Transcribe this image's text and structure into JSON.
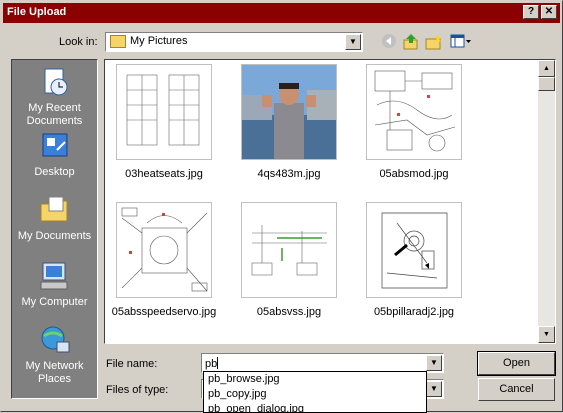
{
  "window": {
    "title": "File Upload",
    "help_glyph": "?",
    "close_glyph": "✕"
  },
  "lookin": {
    "label": "Look in:",
    "value": "My Pictures"
  },
  "toolbar": {
    "back_icon": "back-arrow-icon",
    "up_icon": "up-folder-icon",
    "new_folder_icon": "new-folder-icon",
    "views_icon": "views-menu-icon"
  },
  "places": [
    {
      "label": "My Recent Documents",
      "icon": "recent-documents-icon"
    },
    {
      "label": "Desktop",
      "icon": "desktop-icon"
    },
    {
      "label": "My Documents",
      "icon": "my-documents-icon"
    },
    {
      "label": "My Computer",
      "icon": "my-computer-icon"
    },
    {
      "label": "My Network Places",
      "icon": "network-places-icon"
    }
  ],
  "files": [
    {
      "name": "03heatseats.jpg"
    },
    {
      "name": "4qs483m.jpg"
    },
    {
      "name": "05absmod.jpg"
    },
    {
      "name": "05absspeedservo.jpg"
    },
    {
      "name": "05absvss.jpg"
    },
    {
      "name": "05bpillaradj2.jpg"
    }
  ],
  "filename": {
    "label": "File name:",
    "value": "pb"
  },
  "filetype": {
    "label": "Files of type:"
  },
  "buttons": {
    "open": "Open",
    "cancel": "Cancel"
  },
  "autocomplete": [
    "pb_browse.jpg",
    "pb_copy.jpg",
    "pb_open_dialog.jpg"
  ],
  "colors": {
    "title_bar": "#8b0000",
    "places_bar": "#808080"
  }
}
